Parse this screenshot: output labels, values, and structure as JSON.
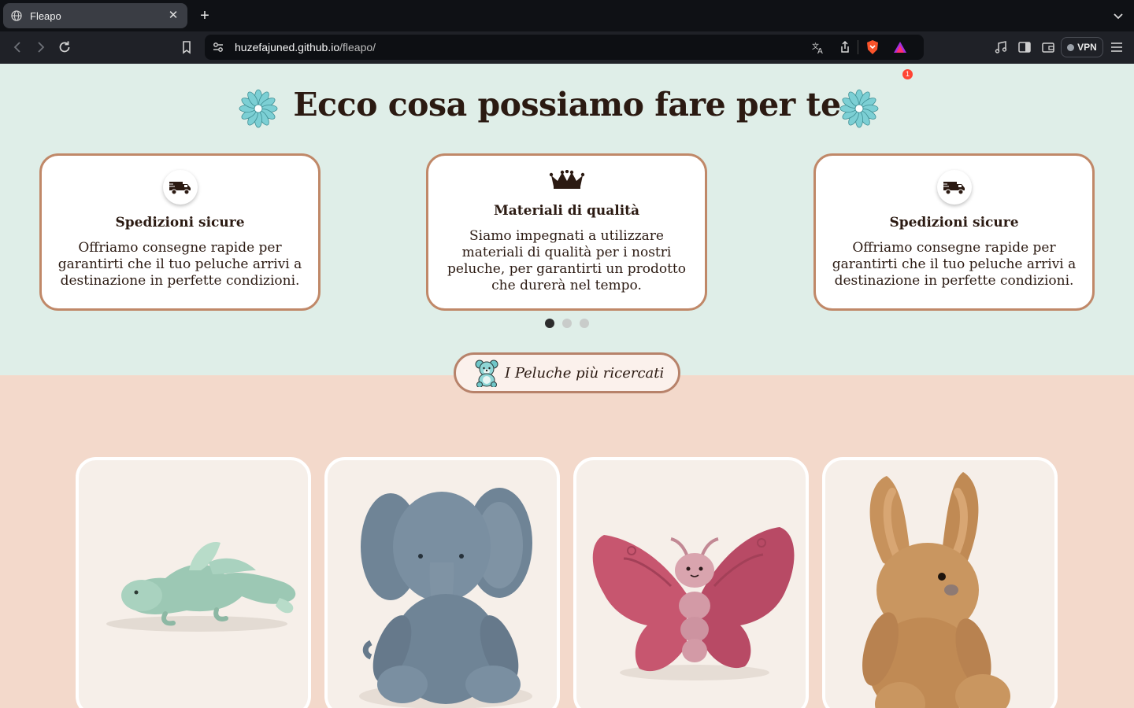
{
  "browser": {
    "tab_title": "Fleapo",
    "url_host": "huzefajuned.github.io",
    "url_path": "/fleapo/",
    "vpn_label": "VPN",
    "notification_count": "1"
  },
  "hero": {
    "heading": "Ecco cosa possiamo fare per te"
  },
  "services": [
    {
      "icon": "truck-icon",
      "title": "Spedizioni sicure",
      "desc": "Offriamo consegne rapide per garantirti che il tuo peluche arrivi a destinazione in perfette condizioni."
    },
    {
      "icon": "crown-icon",
      "title": "Materiali di qualità",
      "desc": "Siamo impegnati a utilizzare materiali di qualità per i nostri peluche, per garantirti un prodotto che durerà nel tempo."
    },
    {
      "icon": "truck-icon",
      "title": "Spedizioni sicure",
      "desc": "Offriamo consegne rapide per garantirti che il tuo peluche arrivi a destinazione in perfette condizioni."
    }
  ],
  "carousel": {
    "active_index": 0,
    "count": 3
  },
  "popular": {
    "label": "I Peluche più ricercati"
  },
  "products": [
    {
      "image": "green-dragon-plush"
    },
    {
      "image": "grey-elephant-plush"
    },
    {
      "image": "pink-butterfly-plush"
    },
    {
      "image": "brown-bunny-plush"
    }
  ],
  "colors": {
    "mint_bg": "#dfeee8",
    "peach_bg": "#f3d9cb",
    "card_border": "#c08868",
    "text_dark": "#2b1a12"
  }
}
